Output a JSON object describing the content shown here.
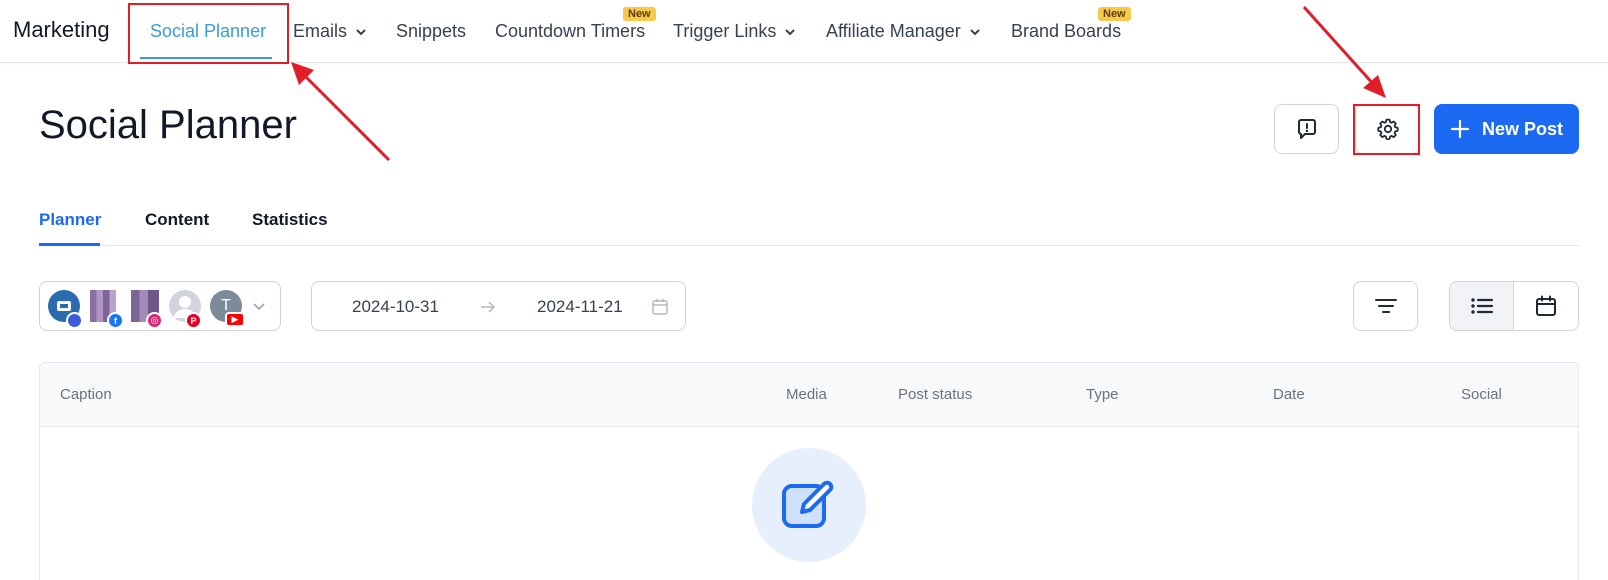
{
  "topnav": {
    "brand": "Marketing",
    "items": [
      {
        "label": "Social Planner",
        "active": true
      },
      {
        "label": "Emails",
        "dropdown": true
      },
      {
        "label": "Snippets"
      },
      {
        "label": "Countdown Timers",
        "badge": "New"
      },
      {
        "label": "Trigger Links",
        "dropdown": true
      },
      {
        "label": "Affiliate Manager",
        "dropdown": true
      },
      {
        "label": "Brand Boards",
        "badge": "New"
      }
    ]
  },
  "header": {
    "title": "Social Planner",
    "new_post_label": "New Post"
  },
  "tabs": [
    {
      "label": "Planner",
      "active": true
    },
    {
      "label": "Content"
    },
    {
      "label": "Statistics"
    }
  ],
  "filters": {
    "accounts_avatar_letter": "T",
    "date_start": "2024-10-31",
    "date_end": "2024-11-21"
  },
  "table": {
    "columns": [
      "Caption",
      "Media",
      "Post status",
      "Type",
      "Date",
      "Social"
    ]
  },
  "colors": {
    "accent_blue": "#1d6af2",
    "nav_active": "#3b9bd8",
    "annotation_red": "#e11d2a",
    "badge_yellow": "#f6c94a"
  },
  "icons": [
    "chevron-down-icon",
    "feedback-icon",
    "gear-icon",
    "plus-icon",
    "arrow-right-icon",
    "calendar-icon",
    "filter-icon",
    "list-view-icon",
    "calendar-view-icon",
    "edit-icon",
    "facebook-icon",
    "instagram-icon",
    "pinterest-icon",
    "youtube-icon"
  ]
}
